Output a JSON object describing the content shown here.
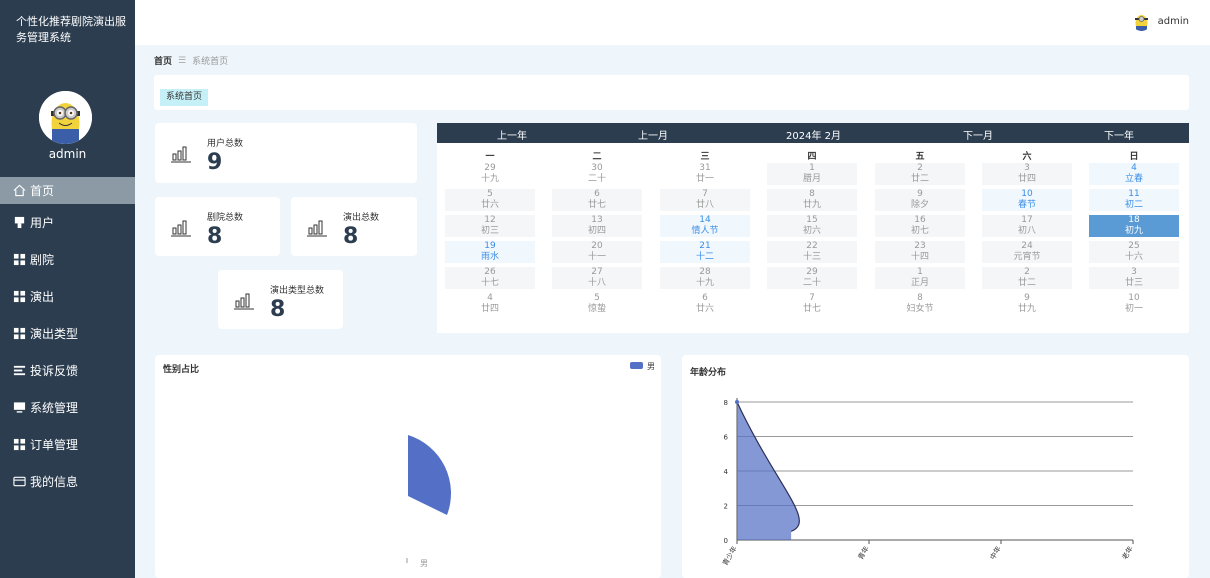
{
  "sidebar": {
    "title": "个性化推荐剧院演出服务管理系统",
    "username": "admin",
    "menu": [
      {
        "label": "首页",
        "icon": "home-icon"
      },
      {
        "label": "用户",
        "icon": "user-icon"
      },
      {
        "label": "剧院",
        "icon": "grid-icon"
      },
      {
        "label": "演出",
        "icon": "grid-icon"
      },
      {
        "label": "演出类型",
        "icon": "grid-icon"
      },
      {
        "label": "投诉反馈",
        "icon": "list-icon"
      },
      {
        "label": "系统管理",
        "icon": "monitor-icon"
      },
      {
        "label": "订单管理",
        "icon": "grid-icon"
      },
      {
        "label": "我的信息",
        "icon": "card-icon"
      }
    ]
  },
  "topbar": {
    "username": "admin"
  },
  "breadcrumb": {
    "home": "首页",
    "current": "系统首页"
  },
  "tabs": {
    "active": "系统首页"
  },
  "stats": [
    {
      "label": "用户总数",
      "value": "9"
    },
    {
      "label": "剧院总数",
      "value": "8"
    },
    {
      "label": "演出总数",
      "value": "8"
    },
    {
      "label": "演出类型总数",
      "value": "8"
    }
  ],
  "calendar": {
    "prev_year": "上一年",
    "prev_month": "上一月",
    "current": "2024年 2月",
    "next_month": "下一月",
    "next_year": "下一年",
    "weekdays": [
      "一",
      "二",
      "三",
      "四",
      "五",
      "六",
      "日"
    ],
    "days": [
      {
        "n": "29",
        "l": "十九"
      },
      {
        "n": "30",
        "l": "二十"
      },
      {
        "n": "31",
        "l": "廿一"
      },
      {
        "n": "1",
        "l": "腊月"
      },
      {
        "n": "2",
        "l": "廿二"
      },
      {
        "n": "3",
        "l": "廿四"
      },
      {
        "n": "4",
        "l": "立春"
      },
      {
        "n": "5",
        "l": "廿六"
      },
      {
        "n": "6",
        "l": "廿七"
      },
      {
        "n": "7",
        "l": "廿八"
      },
      {
        "n": "8",
        "l": "廿九"
      },
      {
        "n": "9",
        "l": "除夕"
      },
      {
        "n": "10",
        "l": "春节"
      },
      {
        "n": "11",
        "l": "初二"
      },
      {
        "n": "12",
        "l": "初三"
      },
      {
        "n": "13",
        "l": "初四"
      },
      {
        "n": "14",
        "l": "情人节"
      },
      {
        "n": "15",
        "l": "初六"
      },
      {
        "n": "16",
        "l": "初七"
      },
      {
        "n": "17",
        "l": "初八"
      },
      {
        "n": "18",
        "l": "初九"
      },
      {
        "n": "19",
        "l": "雨水"
      },
      {
        "n": "20",
        "l": "十一"
      },
      {
        "n": "21",
        "l": "十二"
      },
      {
        "n": "22",
        "l": "十三"
      },
      {
        "n": "23",
        "l": "十四"
      },
      {
        "n": "24",
        "l": "元宵节"
      },
      {
        "n": "25",
        "l": "十六"
      },
      {
        "n": "26",
        "l": "十七"
      },
      {
        "n": "27",
        "l": "十八"
      },
      {
        "n": "28",
        "l": "十九"
      },
      {
        "n": "29",
        "l": "二十"
      },
      {
        "n": "1",
        "l": "正月"
      },
      {
        "n": "2",
        "l": "廿二"
      },
      {
        "n": "3",
        "l": "廿三"
      },
      {
        "n": "4",
        "l": "廿四"
      },
      {
        "n": "5",
        "l": "惊蛰"
      },
      {
        "n": "6",
        "l": "廿六"
      },
      {
        "n": "7",
        "l": "廿七"
      },
      {
        "n": "8",
        "l": "妇女节"
      },
      {
        "n": "9",
        "l": "廿九"
      },
      {
        "n": "10",
        "l": "初一"
      }
    ]
  },
  "chart_data": [
    {
      "type": "pie",
      "title": "性别占比",
      "legend": [
        "男"
      ],
      "legend_position": "top-right",
      "slices": [
        {
          "name": "男",
          "value": 1
        }
      ],
      "color": "#5470c6"
    },
    {
      "type": "area",
      "title": "年龄分布",
      "categories": [
        "青少年",
        "青年",
        "中年",
        "老年"
      ],
      "values": [
        8,
        0.5,
        null,
        null
      ],
      "ylim": [
        0,
        8
      ],
      "yticks": [
        0,
        2,
        4,
        6,
        8
      ],
      "grid": true,
      "color": "#5470c6"
    }
  ]
}
